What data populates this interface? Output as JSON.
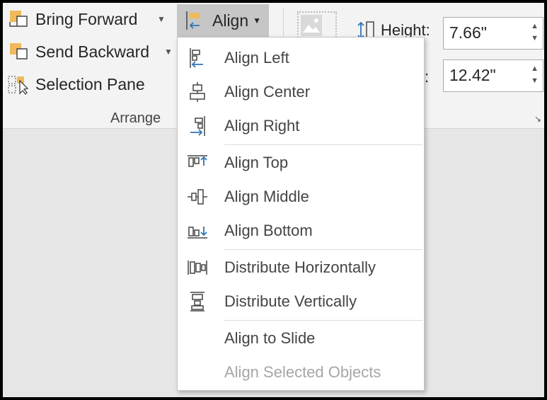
{
  "ribbon": {
    "bring_forward": "Bring Forward",
    "send_backward": "Send Backward",
    "selection_pane": "Selection Pane",
    "group_label": "Arrange",
    "align_label": "Align",
    "height_label": "Height:",
    "height_value": "7.66\"",
    "width_label": ":",
    "width_value": "12.42\""
  },
  "menu": {
    "items": [
      {
        "label": "Align Left",
        "icon": "align-left-icon"
      },
      {
        "label": "Align Center",
        "icon": "align-center-icon"
      },
      {
        "label": "Align Right",
        "icon": "align-right-icon"
      },
      {
        "label": "Align Top",
        "icon": "align-top-icon"
      },
      {
        "label": "Align Middle",
        "icon": "align-middle-icon"
      },
      {
        "label": "Align Bottom",
        "icon": "align-bottom-icon"
      },
      {
        "label": "Distribute Horizontally",
        "icon": "distribute-horizontally-icon"
      },
      {
        "label": "Distribute Vertically",
        "icon": "distribute-vertically-icon"
      },
      {
        "label": "Align to Slide",
        "icon": ""
      },
      {
        "label": "Align Selected Objects",
        "icon": "",
        "disabled": true
      }
    ]
  },
  "colors": {
    "accent_orange": "#f0b95b",
    "accent_blue": "#2e75b6"
  }
}
